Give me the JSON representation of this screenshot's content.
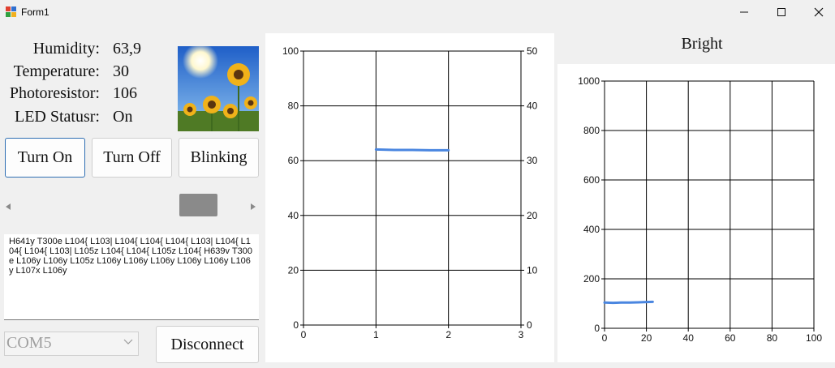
{
  "window": {
    "title": "Form1"
  },
  "readings": {
    "humidity_label": "Humidity:",
    "humidity_value": "63,9",
    "temperature_label": "Temperature:",
    "temperature_value": "30",
    "photoresistor_label": "Photoresistor:",
    "photoresistor_value": "106",
    "led_label": "LED Statusr:",
    "led_value": "On"
  },
  "buttons": {
    "turn_on": "Turn On",
    "turn_off": "Turn Off",
    "blinking": "Blinking",
    "disconnect": "Disconnect"
  },
  "slider": {
    "value_fraction": 0.85
  },
  "log_text": " H641y T300e L104{ L103| L104{ L104{ L104{ L103| L104{ L104{ L104{ L103| L105z L104{ L104{ L105z L104{ H639v T300e L106y L106y L105z L106y L106y L106y L106y L106y L106y L107x L106y",
  "port": {
    "selected": "COM5"
  },
  "colors": {
    "series": "#4a86e0",
    "accent": "#2f6fb3"
  },
  "chart_data": [
    {
      "type": "line",
      "title": "",
      "xlim": [
        0,
        3
      ],
      "ylim": [
        0,
        100
      ],
      "y2lim": [
        0,
        50
      ],
      "x_ticks": [
        0,
        1,
        2,
        3
      ],
      "y_ticks": [
        0,
        20,
        40,
        60,
        80,
        100
      ],
      "y2_ticks": [
        0,
        10,
        20,
        30,
        40,
        50
      ],
      "grid": true,
      "series": [
        {
          "x": [
            1.0,
            1.25,
            1.5,
            1.75,
            2.0
          ],
          "y": [
            64.1,
            63.9,
            63.9,
            63.8,
            63.8
          ]
        }
      ]
    },
    {
      "type": "line",
      "title": "Bright",
      "xlim": [
        0,
        100
      ],
      "ylim": [
        0,
        1000
      ],
      "x_ticks": [
        0,
        20,
        40,
        60,
        80,
        100
      ],
      "y_ticks": [
        0,
        200,
        400,
        600,
        800,
        1000
      ],
      "grid": true,
      "series": [
        {
          "x": [
            0,
            4,
            8,
            12,
            16,
            20,
            23
          ],
          "y": [
            104,
            103,
            104,
            104,
            105,
            106,
            107
          ]
        }
      ]
    }
  ]
}
